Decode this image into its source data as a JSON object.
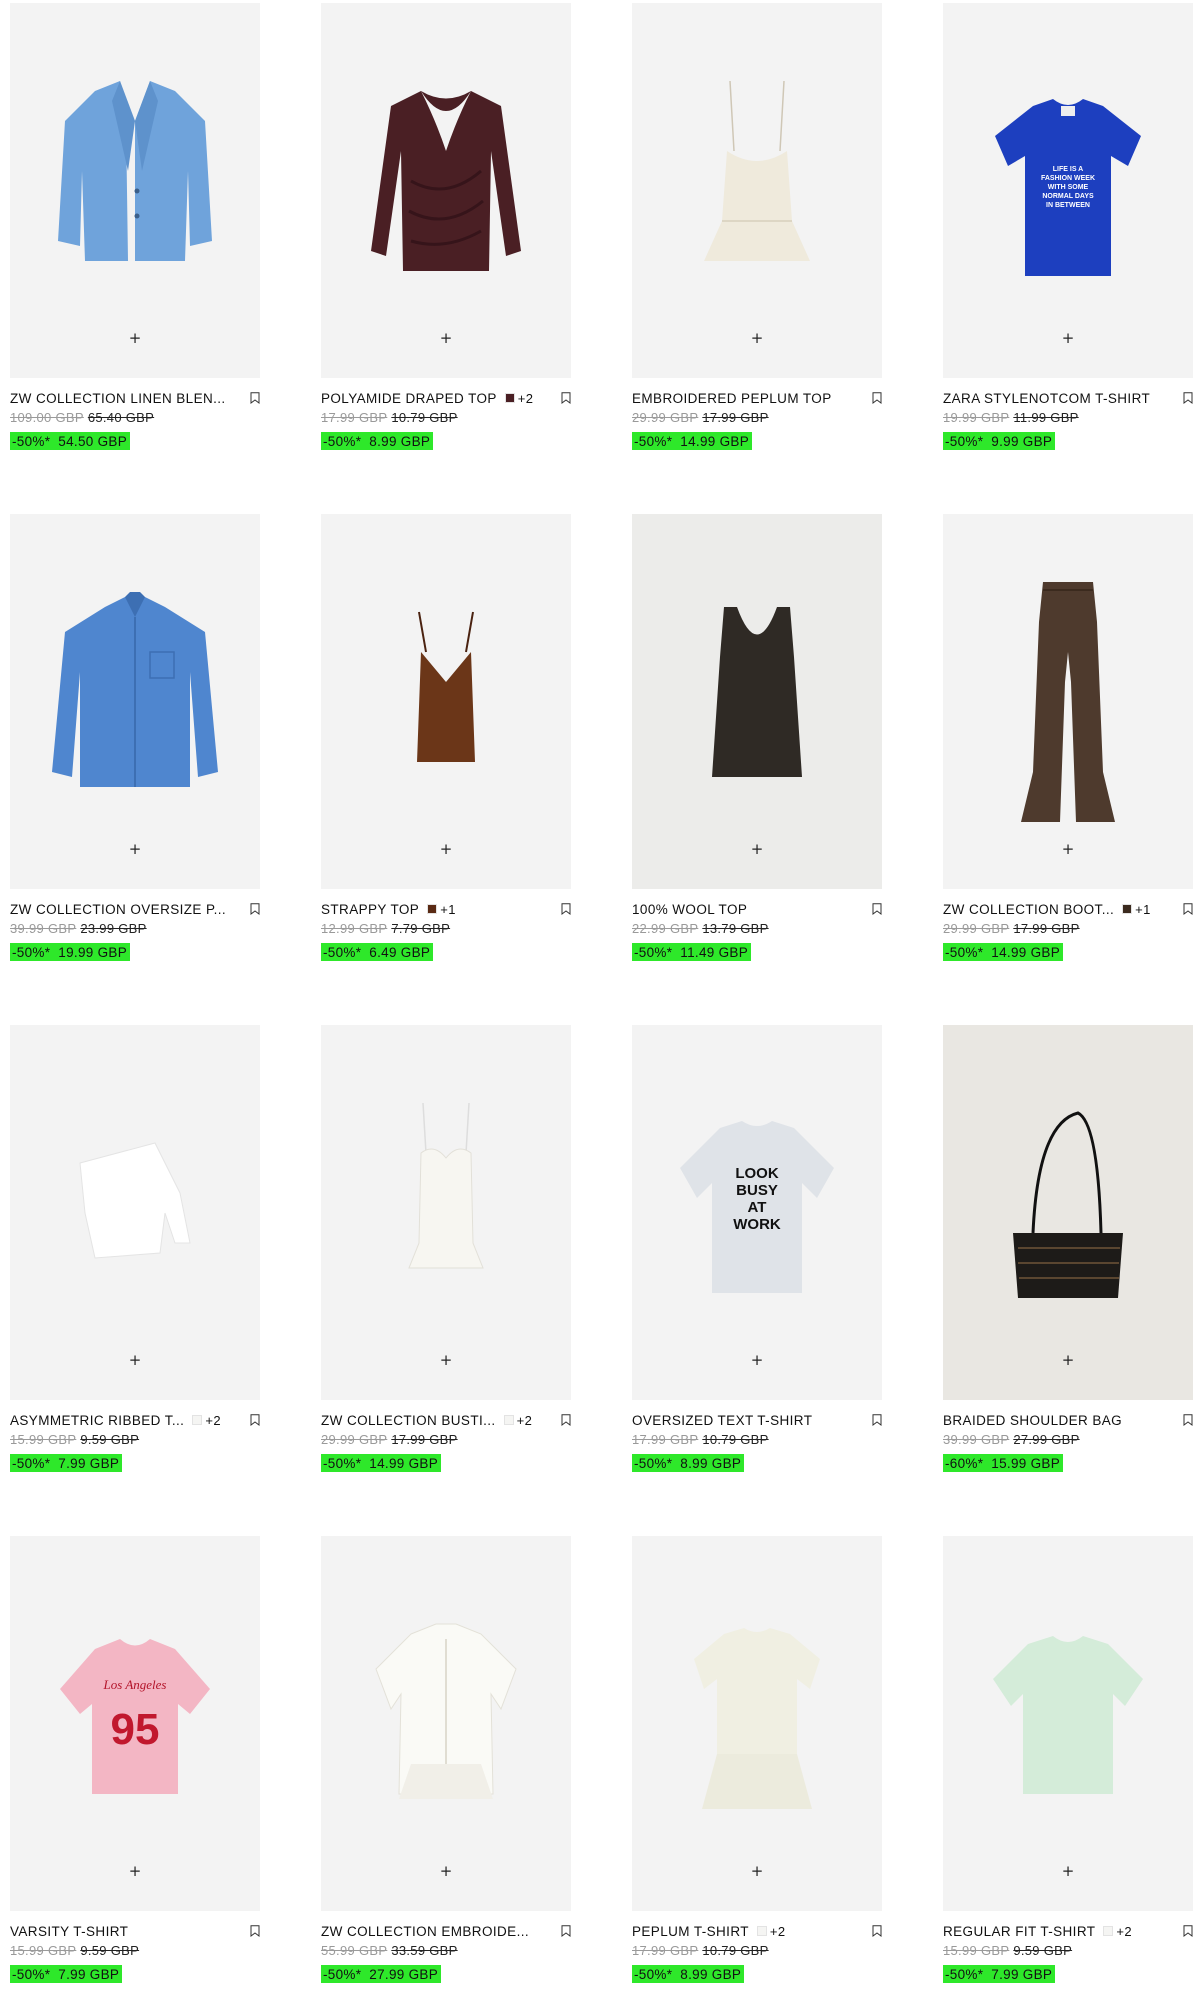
{
  "colors": {
    "sale_highlight": "#2ee82a",
    "image_bg": "#f3f3f3"
  },
  "icons": {
    "add": "plus-icon",
    "bookmark": "bookmark-icon"
  },
  "plus_glyph": "+",
  "products": [
    {
      "name": "ZW COLLECTION LINEN BLEN...",
      "original_price": "109.00 GBP",
      "previous_price": "65.40 GBP",
      "discount": "-50%*",
      "sale_price": "54.50 GBP",
      "image": "blue-linen-blazer"
    },
    {
      "name": "POLYAMIDE DRAPED TOP",
      "swatch_color": "#4a1f24",
      "more_colors": "+2",
      "original_price": "17.99 GBP",
      "previous_price": "10.79 GBP",
      "discount": "-50%*",
      "sale_price": "8.99 GBP",
      "image": "burgundy-draped-top"
    },
    {
      "name": "EMBROIDERED PEPLUM TOP",
      "original_price": "29.99 GBP",
      "previous_price": "17.99 GBP",
      "discount": "-50%*",
      "sale_price": "14.99 GBP",
      "image": "cream-peplum-cami"
    },
    {
      "name": "ZARA STYLENOTCOM T-SHIRT",
      "original_price": "19.99 GBP",
      "previous_price": "11.99 GBP",
      "discount": "-50%*",
      "sale_price": "9.99 GBP",
      "image": "blue-graphic-tshirt",
      "print_text": "LIFE IS A FASHION WEEK WITH SOME NORMAL DAYS IN BETWEEN"
    },
    {
      "name": "ZW COLLECTION OVERSIZE P...",
      "original_price": "39.99 GBP",
      "previous_price": "23.99 GBP",
      "discount": "-50%*",
      "sale_price": "19.99 GBP",
      "image": "blue-oversize-shirt"
    },
    {
      "name": "STRAPPY TOP",
      "swatch_color": "#5a2a14",
      "more_colors": "+1",
      "original_price": "12.99 GBP",
      "previous_price": "7.79 GBP",
      "discount": "-50%*",
      "sale_price": "6.49 GBP",
      "image": "brown-strappy-top"
    },
    {
      "name": "100% WOOL TOP",
      "original_price": "22.99 GBP",
      "previous_price": "13.79 GBP",
      "discount": "-50%*",
      "sale_price": "11.49 GBP",
      "image": "dark-wool-tank"
    },
    {
      "name": "ZW COLLECTION BOOT...",
      "swatch_color": "#3b2a1e",
      "more_colors": "+1",
      "original_price": "29.99 GBP",
      "previous_price": "17.99 GBP",
      "discount": "-50%*",
      "sale_price": "14.99 GBP",
      "image": "brown-bootcut-jeans"
    },
    {
      "name": "ASYMMETRIC RIBBED T...",
      "swatch_color": "#f5f5f3",
      "more_colors": "+2",
      "original_price": "15.99 GBP",
      "previous_price": "9.59 GBP",
      "discount": "-50%*",
      "sale_price": "7.99 GBP",
      "image": "white-asymmetric-top"
    },
    {
      "name": "ZW COLLECTION BUSTI...",
      "swatch_color": "#f5f5f3",
      "more_colors": "+2",
      "original_price": "29.99 GBP",
      "previous_price": "17.99 GBP",
      "discount": "-50%*",
      "sale_price": "14.99 GBP",
      "image": "white-bustier-top"
    },
    {
      "name": "OVERSIZED TEXT T-SHIRT",
      "original_price": "17.99 GBP",
      "previous_price": "10.79 GBP",
      "discount": "-50%*",
      "sale_price": "8.99 GBP",
      "image": "grey-text-tshirt",
      "print_text": "LOOK BUSY AT WORK"
    },
    {
      "name": "BRAIDED SHOULDER BAG",
      "original_price": "39.99 GBP",
      "previous_price": "27.99 GBP",
      "discount": "-60%*",
      "sale_price": "15.99 GBP",
      "image": "black-braided-bag"
    },
    {
      "name": "VARSITY T-SHIRT",
      "original_price": "15.99 GBP",
      "previous_price": "9.59 GBP",
      "discount": "-50%*",
      "sale_price": "7.99 GBP",
      "image": "pink-varsity-tshirt",
      "print_text": "Los Angeles 95"
    },
    {
      "name": "ZW COLLECTION EMBROIDE...",
      "original_price": "55.99 GBP",
      "previous_price": "33.59 GBP",
      "discount": "-50%*",
      "sale_price": "27.99 GBP",
      "image": "white-embroidered-shirt"
    },
    {
      "name": "PEPLUM T-SHIRT",
      "swatch_color": "#f5f5f3",
      "more_colors": "+2",
      "original_price": "17.99 GBP",
      "previous_price": "10.79 GBP",
      "discount": "-50%*",
      "sale_price": "8.99 GBP",
      "image": "cream-peplum-tshirt"
    },
    {
      "name": "REGULAR FIT T-SHIRT",
      "swatch_color": "#f5f5f3",
      "more_colors": "+2",
      "original_price": "15.99 GBP",
      "previous_price": "9.59 GBP",
      "discount": "-50%*",
      "sale_price": "7.99 GBP",
      "image": "mint-tshirt"
    }
  ]
}
